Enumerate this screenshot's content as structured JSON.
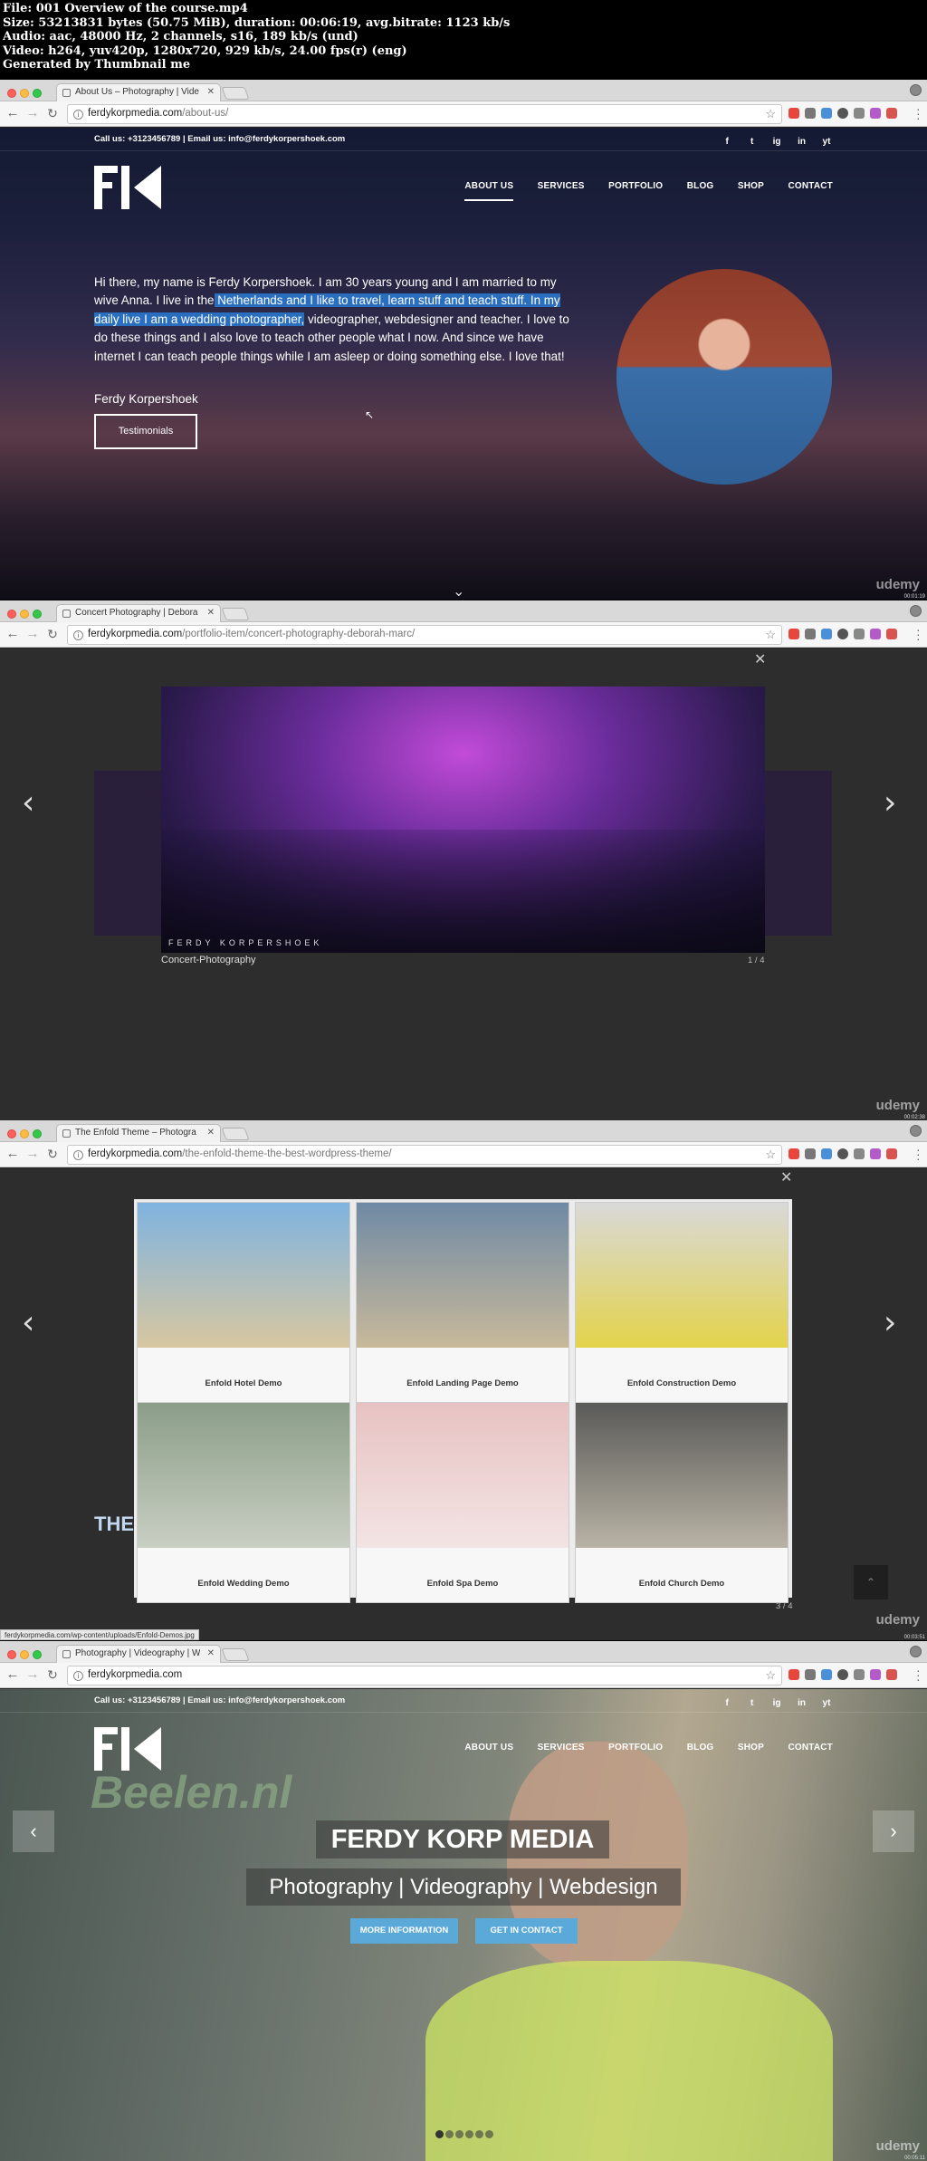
{
  "meta": {
    "lines": [
      "File: 001 Overview of the course.mp4",
      "Size: 53213831 bytes (50.75 MiB), duration: 00:06:19, avg.bitrate: 1123 kb/s",
      "Audio: aac, 48000 Hz, 2 channels, s16, 189 kb/s (und)",
      "Video: h264, yuv420p, 1280x720, 929 kb/s, 24.00 fps(r) (eng)",
      "Generated by Thumbnail me"
    ]
  },
  "frames": [
    {
      "tab_title": "About Us – Photography | Vide",
      "url_host": "ferdykorpmedia.com",
      "url_path": "/about-us/",
      "timecode": "00:01:19"
    },
    {
      "tab_title": "Concert Photography | Debora",
      "url_host": "ferdykorpmedia.com",
      "url_path": "/portfolio-item/concert-photography-deborah-marc/",
      "timecode": "00:02:38"
    },
    {
      "tab_title": "The Enfold Theme – Photogra",
      "url_host": "ferdykorpmedia.com",
      "url_path": "/the-enfold-theme-the-best-wordpress-theme/",
      "timecode": "00:03:51"
    },
    {
      "tab_title": "Photography | Videography | W",
      "url_host": "ferdykorpmedia.com",
      "url_path": "",
      "timecode": "00:05:11"
    }
  ],
  "site": {
    "contact_line": "Call us: +3123456789 | Email us: info@ferdykorpershoek.com",
    "nav": [
      "ABOUT US",
      "SERVICES",
      "PORTFOLIO",
      "BLOG",
      "SHOP",
      "CONTACT"
    ],
    "social": [
      "f",
      "t",
      "ig",
      "in",
      "yt"
    ]
  },
  "about": {
    "intro_a": "Hi there, my name is Ferdy Korpershoek. I am 30 years young and I am married to my wive Anna. I live in the",
    "intro_hl": " Netherlands and I like to travel, learn stuff and teach stuff. In my daily live I am a wedding photographer,",
    "intro_b": " videographer, webdesigner and teacher. I love to do these things and I also love to teach other people what I now. And since we have internet I can teach people things while I am asleep or doing something else. I love that!",
    "signature": "Ferdy Korpershoek",
    "button": "Testimonials"
  },
  "lightbox_concert": {
    "watermark": "FERDY KORPERSHOEK",
    "caption": "Concert-Photography",
    "counter": "1 / 4"
  },
  "lightbox_enfold": {
    "demos": [
      "Enfold Hotel Demo",
      "Enfold Landing Page Demo",
      "Enfold Construction Demo",
      "Enfold Wedding Demo",
      "Enfold Spa Demo",
      "Enfold Church Demo"
    ],
    "counter": "3 / 4",
    "status_url": "ferdykorpmedia.com/wp-content/uploads/Enfold-Demos.jpg",
    "behind_heading": "THE FULLSCREEN SLIDER"
  },
  "home": {
    "title": "FERDY KORP MEDIA",
    "subtitle": "Photography | Videography | Webdesign",
    "btn_more": "MORE INFORMATION",
    "btn_contact": "GET IN CONTACT",
    "bg_text": "Beelen.nl"
  },
  "brand": {
    "udemy": "udemy"
  },
  "colors": {
    "highlight": "#2a6fbf",
    "button_blue": "#5aa9d9"
  }
}
